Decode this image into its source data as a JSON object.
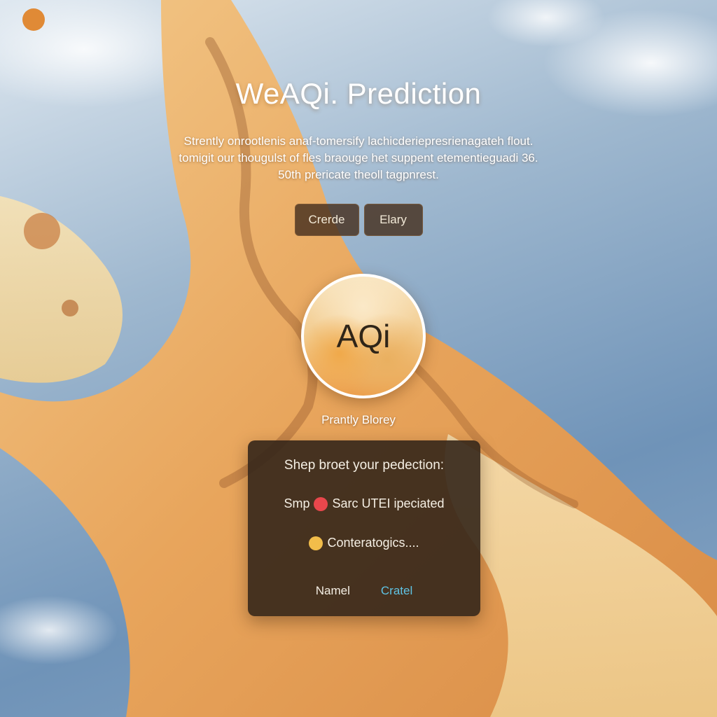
{
  "header": {
    "title": "WeAQi. Prediction",
    "description_lines": [
      "Strently onrootlenis anaf-tomersify lachicderiepresrienagateh flout.",
      "tomigit our thougulst of fles braouge het suppent etementieguadi 36.",
      "50th prericate theoll tagpnrest."
    ]
  },
  "actions": {
    "create_label": "Crerde",
    "early_label": "Elary"
  },
  "aqi": {
    "label": "AQi",
    "caption": "Prantly Blorey"
  },
  "panel": {
    "heading": "Shep broet your pedection:",
    "options": [
      {
        "prefix": "Smp",
        "text": "Sarc UTEI ipeciated",
        "dot_color": "#e8474c"
      },
      {
        "prefix": "",
        "text": "Conteratogics....",
        "dot_color": "#f2bd4a"
      }
    ],
    "name_label": "Namel",
    "create_label": "Cratel"
  },
  "colors": {
    "panel_bg": "#34261a",
    "link_accent": "#5fc3e4",
    "sand": "#e8a55c"
  }
}
